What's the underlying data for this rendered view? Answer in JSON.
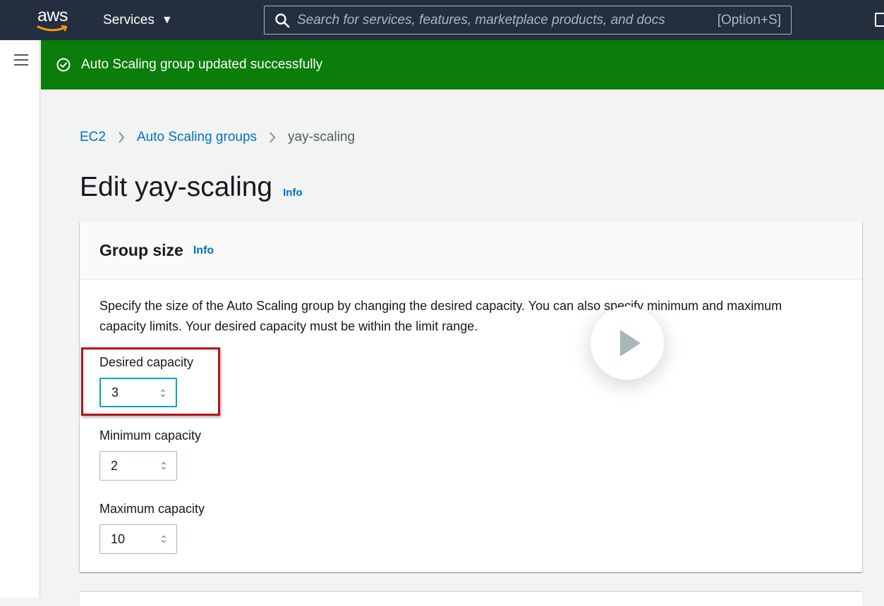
{
  "topnav": {
    "logo_text": "aws",
    "services_label": "Services",
    "search_placeholder": "Search for services, features, marketplace products, and docs",
    "search_shortcut": "[Option+S]"
  },
  "flash": {
    "message": "Auto Scaling group updated successfully",
    "color": "#0a7d0a"
  },
  "breadcrumb": {
    "items": [
      "EC2",
      "Auto Scaling groups"
    ],
    "current": "yay-scaling"
  },
  "page": {
    "title": "Edit yay-scaling",
    "info_label": "Info"
  },
  "group_size": {
    "heading": "Group size",
    "info_label": "Info",
    "description": "Specify the size of the Auto Scaling group by changing the desired capacity. You can also specify minimum and maximum capacity limits. Your desired capacity must be within the limit range.",
    "desired_label": "Desired capacity",
    "desired_value": "3",
    "minimum_label": "Minimum capacity",
    "minimum_value": "2",
    "maximum_label": "Maximum capacity",
    "maximum_value": "10"
  },
  "colors": {
    "nav_bg": "#232f3e",
    "link": "#0073bb",
    "highlight": "#b7121d",
    "focus": "#00a1c9"
  },
  "icons": {
    "play": "play-icon",
    "menu": "hamburger-menu-icon",
    "search": "search-icon",
    "success": "check-circle-icon"
  }
}
